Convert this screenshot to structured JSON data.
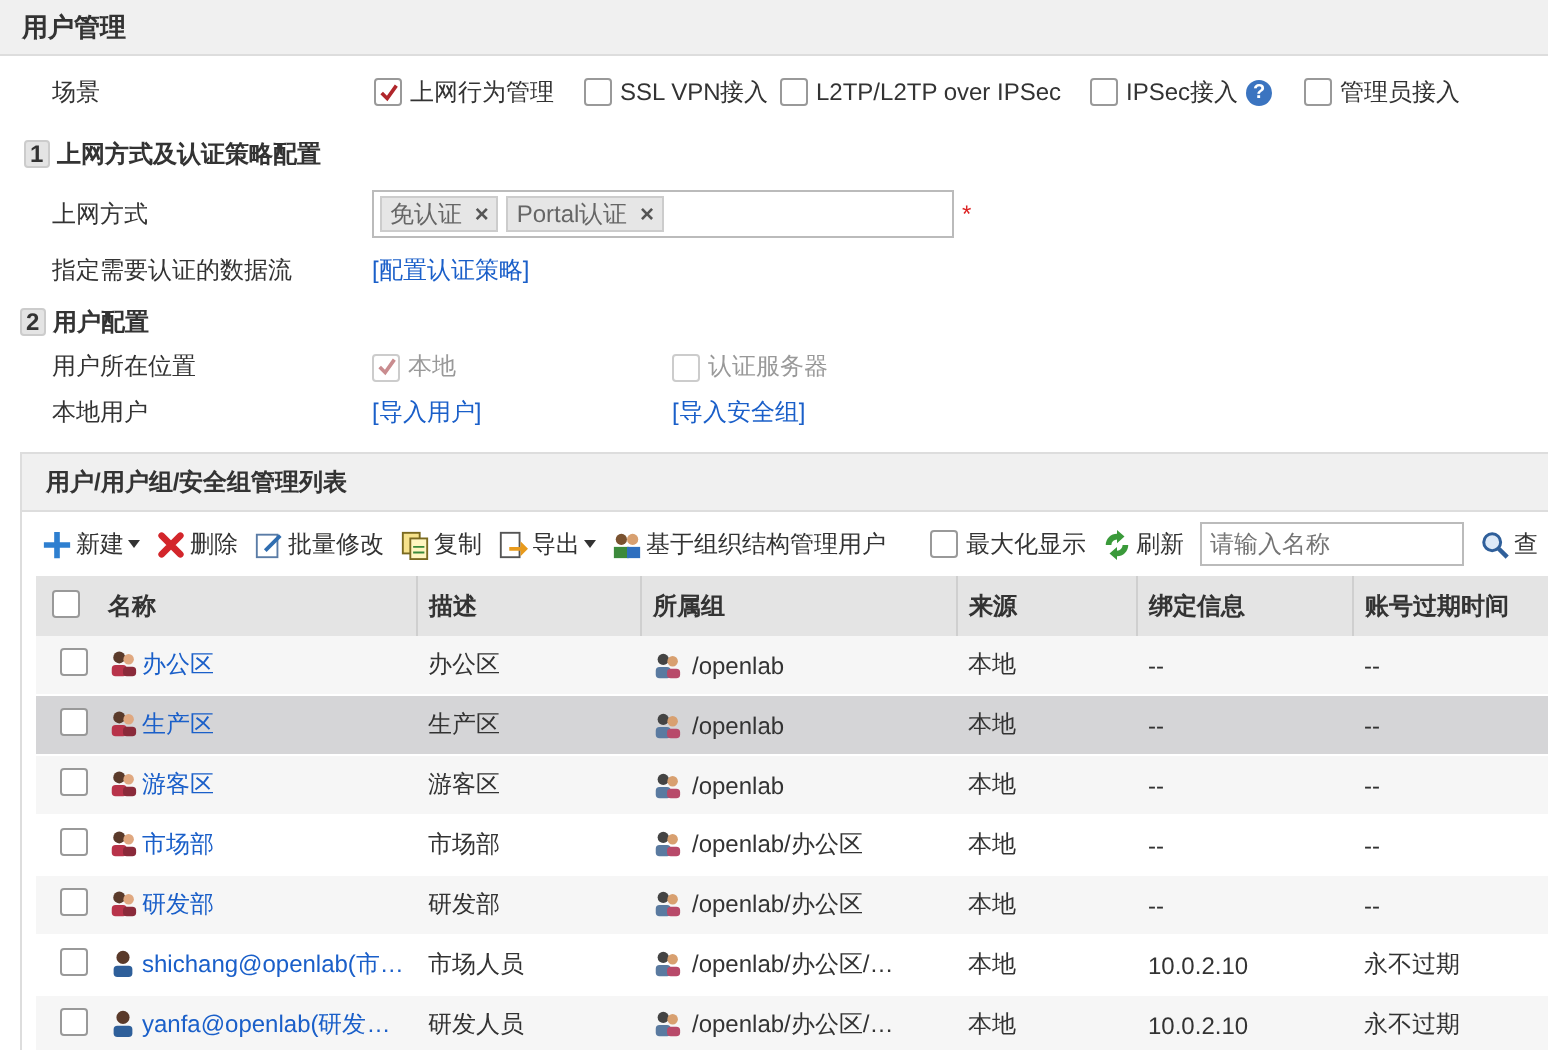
{
  "page_title": "用户管理",
  "scene": {
    "label": "场景",
    "options": [
      {
        "label": "上网行为管理",
        "checked": true
      },
      {
        "label": "SSL VPN接入",
        "checked": false
      },
      {
        "label": "L2TP/L2TP over IPSec",
        "checked": false
      },
      {
        "label": "IPSec接入",
        "checked": false,
        "help": "?"
      },
      {
        "label": "管理员接入",
        "checked": false
      }
    ]
  },
  "section1": {
    "number": "1",
    "title": "上网方式及认证策略配置",
    "access_label": "上网方式",
    "access_tags": [
      {
        "label": "免认证",
        "remove": "×"
      },
      {
        "label": "Portal认证",
        "remove": "×"
      }
    ],
    "required_mark": "*",
    "flow_label": "指定需要认证的数据流",
    "flow_link": "[配置认证策略]"
  },
  "section2": {
    "number": "2",
    "title": "用户配置",
    "location_label": "用户所在位置",
    "location_options": [
      {
        "label": "本地",
        "checked": true
      },
      {
        "label": "认证服务器",
        "checked": false
      }
    ],
    "local_label": "本地用户",
    "local_links": [
      "[导入用户]",
      "[导入安全组]"
    ]
  },
  "list": {
    "title": "用户/用户组/安全组管理列表",
    "toolbar": [
      {
        "kind": "add",
        "label": "新建",
        "dropdown": true
      },
      {
        "kind": "delete",
        "label": "删除",
        "dropdown": false
      },
      {
        "kind": "edit",
        "label": "批量修改",
        "dropdown": false
      },
      {
        "kind": "copy",
        "label": "复制",
        "dropdown": false
      },
      {
        "kind": "export",
        "label": "导出",
        "dropdown": true
      },
      {
        "kind": "org",
        "label": "基于组织结构管理用户",
        "dropdown": false
      }
    ],
    "maximize": {
      "label": "最大化显示",
      "checked": false
    },
    "refresh": "刷新",
    "search": {
      "placeholder": "请输入名称"
    },
    "query": "查",
    "select_all_checked": false,
    "columns": [
      "名称",
      "描述",
      "所属组",
      "来源",
      "绑定信息",
      "账号过期时间"
    ],
    "rows": [
      {
        "kind": "group",
        "name": "办公区",
        "desc": "办公区",
        "group": "/openlab",
        "source": "本地",
        "binding": "--",
        "expiry": "--",
        "selected": false,
        "checked": false
      },
      {
        "kind": "group",
        "name": "生产区",
        "desc": "生产区",
        "group": "/openlab",
        "source": "本地",
        "binding": "--",
        "expiry": "--",
        "selected": true,
        "checked": false
      },
      {
        "kind": "group",
        "name": "游客区",
        "desc": "游客区",
        "group": "/openlab",
        "source": "本地",
        "binding": "--",
        "expiry": "--",
        "selected": false,
        "checked": false
      },
      {
        "kind": "group",
        "name": "市场部",
        "desc": "市场部",
        "group": "/openlab/办公区",
        "source": "本地",
        "binding": "--",
        "expiry": "--",
        "selected": false,
        "checked": false
      },
      {
        "kind": "group",
        "name": "研发部",
        "desc": "研发部",
        "group": "/openlab/办公区",
        "source": "本地",
        "binding": "--",
        "expiry": "--",
        "selected": false,
        "checked": false
      },
      {
        "kind": "user",
        "name": "shichang@openlab(市…",
        "desc": "市场人员",
        "group": "/openlab/办公区/…",
        "source": "本地",
        "binding": "10.0.2.10",
        "expiry": "永不过期",
        "selected": false,
        "checked": false
      },
      {
        "kind": "user",
        "name": "yanfa@openlab(研发…",
        "desc": "研发人员",
        "group": "/openlab/办公区/…",
        "source": "本地",
        "binding": "10.0.2.10",
        "expiry": "永不过期",
        "selected": false,
        "checked": false
      }
    ]
  }
}
